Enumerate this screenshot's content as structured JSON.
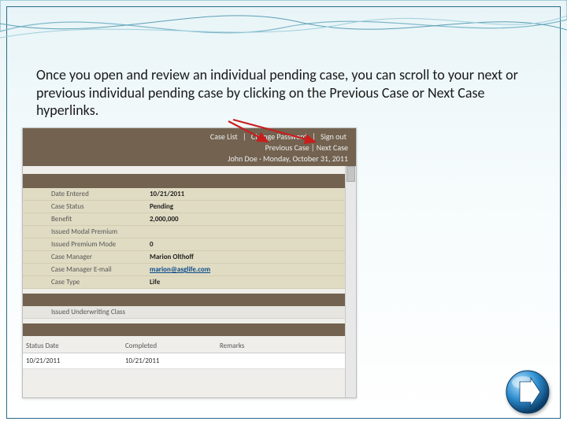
{
  "instruction_text": "Once you open and review an  individual pending case, you can scroll to your next or previous individual pending case by clicking on the Previous Case or Next Case hyperlinks.",
  "top_links": {
    "case_list": "Case List",
    "change_pw": "Change Password",
    "sign_out": "Sign out",
    "prev_case": "Previous Case",
    "next_case": "Next Case"
  },
  "user_line": {
    "name": "John Doe",
    "date": "Monday, October 31, 2011"
  },
  "fields": [
    {
      "label": "Date Entered",
      "value": "10/21/2011"
    },
    {
      "label": "Case Status",
      "value": "Pending"
    },
    {
      "label": "Benefit",
      "value": "2,000,000"
    },
    {
      "label": "Issued Modal Premium",
      "value": ""
    },
    {
      "label": "Issued Premium Mode",
      "value": "0"
    },
    {
      "label": "Case Manager",
      "value": "Marion Olthoff"
    },
    {
      "label": "Case Manager E-mail",
      "value": "marion@asglife.com",
      "link": true
    },
    {
      "label": "Case Type",
      "value": "Life"
    }
  ],
  "uw_label": "Issued Underwriting Class",
  "status_headers": {
    "c1": "Status Date",
    "c2": "Completed",
    "c3": "Remarks"
  },
  "status_row": {
    "c1": "10/21/2011",
    "c2": "10/21/2011"
  },
  "next_button_name": "next-slide-button"
}
